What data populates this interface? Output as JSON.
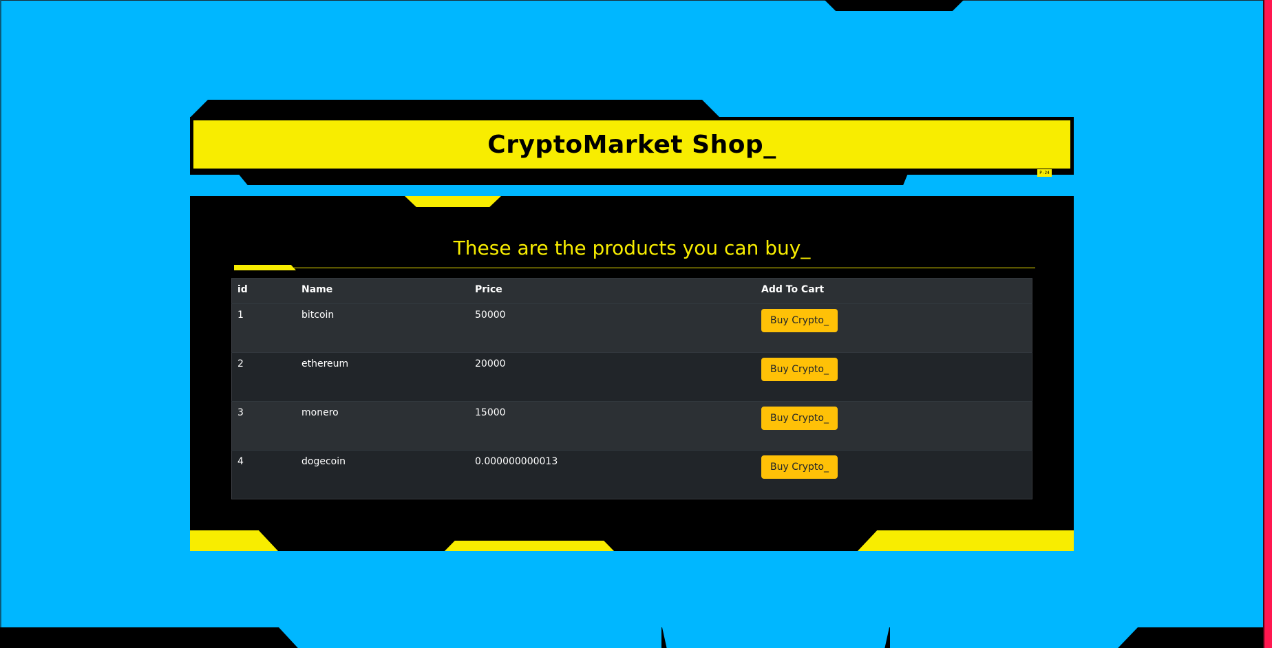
{
  "header": {
    "title": "CryptoMarket Shop_",
    "version_tag": "P-24"
  },
  "main": {
    "title": "These are the products you can buy_",
    "table": {
      "headers": [
        "id",
        "Name",
        "Price",
        "Add To Cart"
      ],
      "rows": [
        {
          "id": "1",
          "name": "bitcoin",
          "price": "50000",
          "button": "Buy Crypto_"
        },
        {
          "id": "2",
          "name": "ethereum",
          "price": "20000",
          "button": "Buy Crypto_"
        },
        {
          "id": "3",
          "name": "monero",
          "price": "15000",
          "button": "Buy Crypto_"
        },
        {
          "id": "4",
          "name": "dogecoin",
          "price": "0.000000000013",
          "button": "Buy Crypto_"
        }
      ]
    }
  },
  "colors": {
    "background": "#00b7ff",
    "accent_yellow": "#f8ed00",
    "button_yellow": "#ffc107",
    "right_stripe": "#ff174f"
  }
}
